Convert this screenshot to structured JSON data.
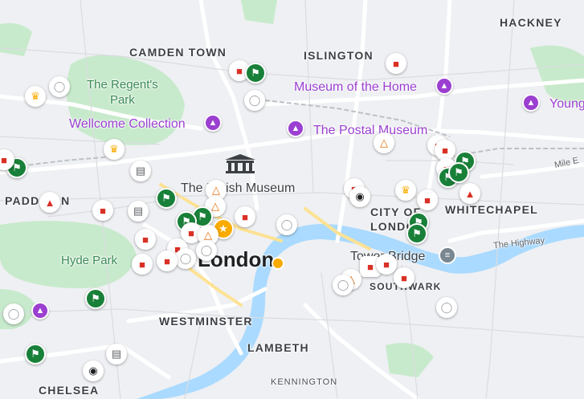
{
  "colors": {
    "land": "#eef0f3",
    "park": "#c8eacc",
    "water": "#aadaff",
    "road_major": "#ffffff",
    "road_yellow": "#fde293",
    "poi_purple": "#9b3fd1",
    "park_text": "#3a8a55"
  },
  "labels": {
    "hackney": "HACKNEY",
    "camden_town": "CAMDEN TOWN",
    "islington": "ISLINGTON",
    "regents_park": "The Regent's\nPark",
    "museum_of_the_home": "Museum of the Home",
    "young": "Young",
    "wellcome_collection": "Wellcome Collection",
    "postal_museum": "The Postal Museum",
    "mile_end": "Mile E",
    "british_museum": "The British Museum",
    "paddington": "PADD  TON",
    "city_of_london": "CITY OF\nLONDON",
    "whitechapel": "WHITECHAPEL",
    "the_highway": "The Highway",
    "hyde_park": "Hyde Park",
    "london": "London",
    "tower_bridge": "Tower Bridge",
    "southwark": "SOUTHWARK",
    "westminster": "WESTMINSTER",
    "lambeth": "LAMBETH",
    "kennington": "KENNINGTON",
    "chelsea": "CHELSEA"
  },
  "icons": {
    "museum": "museum-icon",
    "meat": "steak-icon",
    "flag": "flag-icon",
    "plate": "restaurant-icon",
    "drink": "drink-icon",
    "cart": "shopping-cart-icon",
    "camera": "camera-icon",
    "temple": "temple-icon",
    "circus": "circus-tent-icon",
    "star": "star-icon",
    "bridge": "bridge-icon"
  }
}
